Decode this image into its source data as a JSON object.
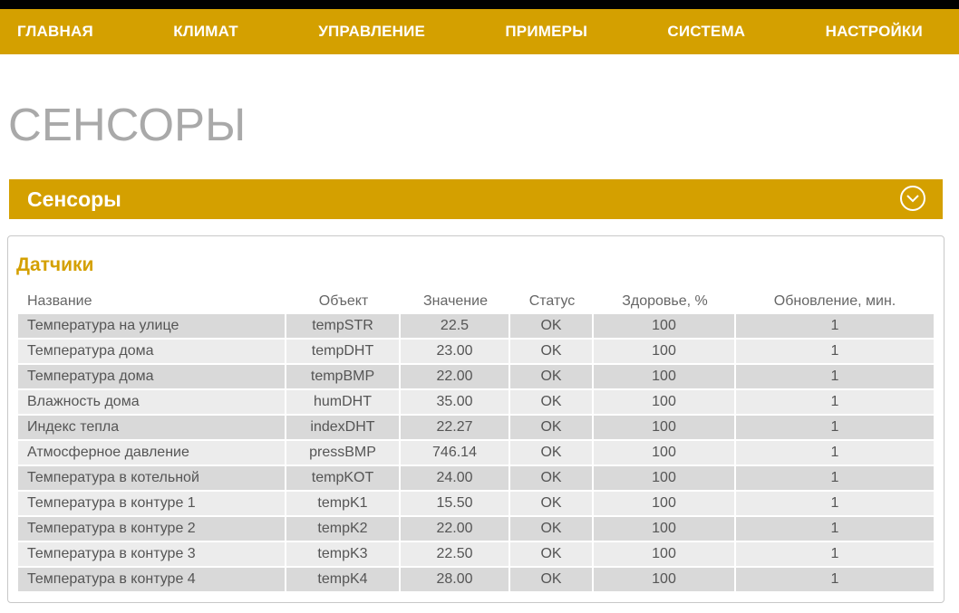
{
  "nav": {
    "items": [
      "ГЛАВНАЯ",
      "КЛИМАТ",
      "УПРАВЛЕНИЕ",
      "ПРИМЕРЫ",
      "СИСТЕМА",
      "НАСТРОЙКИ"
    ]
  },
  "page_title": "СЕНСОРЫ",
  "section": {
    "title": "Сенсоры",
    "collapse_icon": "chevron-down-circle-icon"
  },
  "panel": {
    "title": "Датчики"
  },
  "table": {
    "headers": [
      "Название",
      "Объект",
      "Значение",
      "Статус",
      "Здоровье, %",
      "Обновление, мин."
    ],
    "rows": [
      [
        "Температура на улице",
        "tempSTR",
        "22.5",
        "OK",
        "100",
        "1"
      ],
      [
        "Температура дома",
        "tempDHT",
        "23.00",
        "OK",
        "100",
        "1"
      ],
      [
        "Температура дома",
        "tempBMP",
        "22.00",
        "OK",
        "100",
        "1"
      ],
      [
        "Влажность дома",
        "humDHT",
        "35.00",
        "OK",
        "100",
        "1"
      ],
      [
        "Индекс тепла",
        "indexDHT",
        "22.27",
        "OK",
        "100",
        "1"
      ],
      [
        "Атмосферное давление",
        "pressBMP",
        "746.14",
        "OK",
        "100",
        "1"
      ],
      [
        "Температура в котельной",
        "tempKOT",
        "24.00",
        "OK",
        "100",
        "1"
      ],
      [
        "Температура в контуре 1",
        "tempK1",
        "15.50",
        "OK",
        "100",
        "1"
      ],
      [
        "Температура в контуре 2",
        "tempK2",
        "22.00",
        "OK",
        "100",
        "1"
      ],
      [
        "Температура в контуре 3",
        "tempK3",
        "22.50",
        "OK",
        "100",
        "1"
      ],
      [
        "Температура в контуре 4",
        "tempK4",
        "28.00",
        "OK",
        "100",
        "1"
      ]
    ]
  },
  "colors": {
    "accent": "#d4a000",
    "title_gray": "#a9a9a9",
    "row_odd": "#d9d9d9",
    "row_even": "#ececec"
  }
}
